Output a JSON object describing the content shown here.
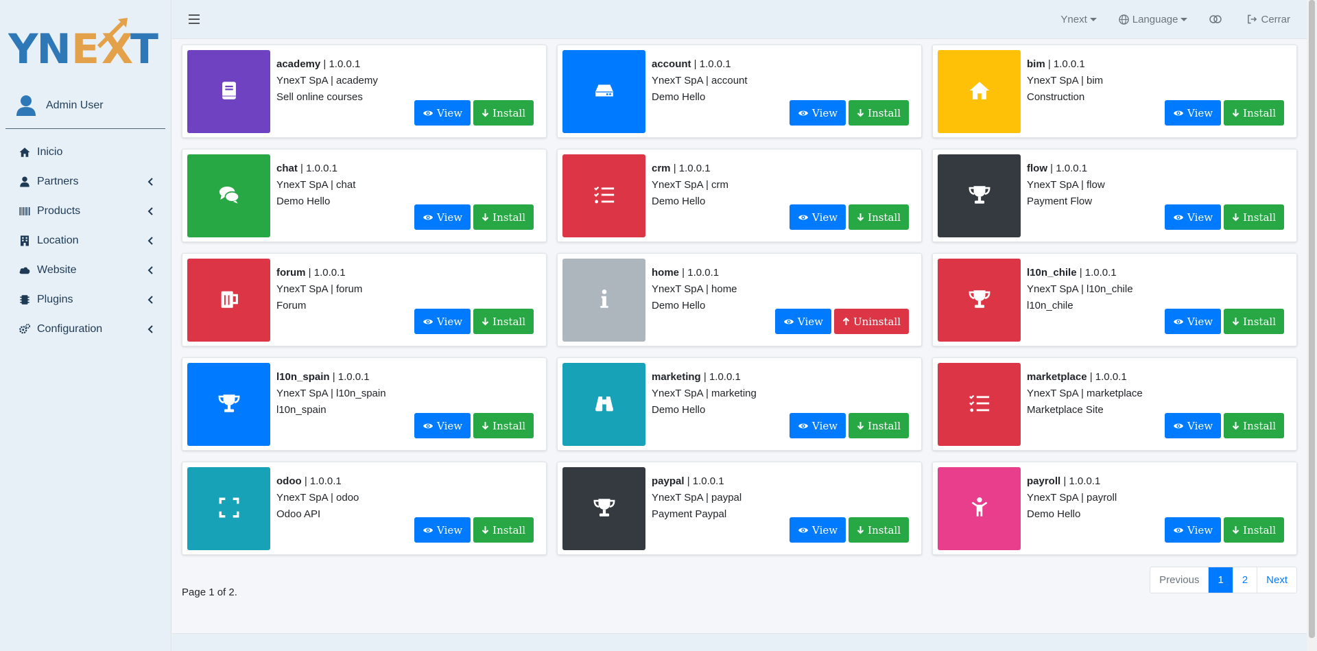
{
  "brand": {
    "logo_text": "YNEXT"
  },
  "user": {
    "name": "Admin User"
  },
  "nav": [
    {
      "label": "Inicio",
      "icon": "home-icon",
      "expandable": false
    },
    {
      "label": "Partners",
      "icon": "user-icon",
      "expandable": true
    },
    {
      "label": "Products",
      "icon": "barcode-icon",
      "expandable": true
    },
    {
      "label": "Location",
      "icon": "building-icon",
      "expandable": true
    },
    {
      "label": "Website",
      "icon": "cloud-icon",
      "expandable": true
    },
    {
      "label": "Plugins",
      "icon": "plugin-icon",
      "expandable": true
    },
    {
      "label": "Configuration",
      "icon": "cogs-icon",
      "expandable": true
    }
  ],
  "topbar": {
    "company": "Ynext",
    "language": "Language",
    "logout": "Cerrar"
  },
  "buttons": {
    "view": "View",
    "install": "Install",
    "uninstall": "Uninstall"
  },
  "modules": [
    {
      "name": "academy",
      "version": "1.0.0.1",
      "vendor": "YnexT SpA | academy",
      "desc": "Sell online courses",
      "color": "#6f42c1",
      "icon": "book-icon",
      "installed": false
    },
    {
      "name": "account",
      "version": "1.0.0.1",
      "vendor": "YnexT SpA | account",
      "desc": "Demo Hello",
      "color": "#007bff",
      "icon": "hdd-icon",
      "installed": false
    },
    {
      "name": "bim",
      "version": "1.0.0.1",
      "vendor": "YnexT SpA | bim",
      "desc": "Construction",
      "color": "#ffc107",
      "icon": "home-icon",
      "installed": false
    },
    {
      "name": "chat",
      "version": "1.0.0.1",
      "vendor": "YnexT SpA | chat",
      "desc": "Demo Hello",
      "color": "#28a745",
      "icon": "comments-icon",
      "installed": false
    },
    {
      "name": "crm",
      "version": "1.0.0.1",
      "vendor": "YnexT SpA | crm",
      "desc": "Demo Hello",
      "color": "#dc3545",
      "icon": "tasks-icon",
      "installed": false
    },
    {
      "name": "flow",
      "version": "1.0.0.1",
      "vendor": "YnexT SpA | flow",
      "desc": "Payment Flow",
      "color": "#343a40",
      "icon": "trophy-icon",
      "installed": false
    },
    {
      "name": "forum",
      "version": "1.0.0.1",
      "vendor": "YnexT SpA | forum",
      "desc": "Forum",
      "color": "#dc3545",
      "icon": "beer-icon",
      "installed": false
    },
    {
      "name": "home",
      "version": "1.0.0.1",
      "vendor": "YnexT SpA | home",
      "desc": "Demo Hello",
      "color": "#adb5bd",
      "icon": "info-icon",
      "installed": true
    },
    {
      "name": "l10n_chile",
      "version": "1.0.0.1",
      "vendor": "YnexT SpA | l10n_chile",
      "desc": "l10n_chile",
      "color": "#dc3545",
      "icon": "trophy-icon",
      "installed": false
    },
    {
      "name": "l10n_spain",
      "version": "1.0.0.1",
      "vendor": "YnexT SpA | l10n_spain",
      "desc": "l10n_spain",
      "color": "#007bff",
      "icon": "trophy-icon",
      "installed": false
    },
    {
      "name": "marketing",
      "version": "1.0.0.1",
      "vendor": "YnexT SpA | marketing",
      "desc": "Demo Hello",
      "color": "#17a2b8",
      "icon": "binoculars-icon",
      "installed": false
    },
    {
      "name": "marketplace",
      "version": "1.0.0.1",
      "vendor": "YnexT SpA | marketplace",
      "desc": "Marketplace Site",
      "color": "#dc3545",
      "icon": "tasks-icon",
      "installed": false
    },
    {
      "name": "odoo",
      "version": "1.0.0.1",
      "vendor": "YnexT SpA | odoo",
      "desc": "Odoo API",
      "color": "#17a2b8",
      "icon": "expand-icon",
      "installed": false
    },
    {
      "name": "paypal",
      "version": "1.0.0.1",
      "vendor": "YnexT SpA | paypal",
      "desc": "Payment Paypal",
      "color": "#343a40",
      "icon": "trophy-icon",
      "installed": false
    },
    {
      "name": "payroll",
      "version": "1.0.0.1",
      "vendor": "YnexT SpA | payroll",
      "desc": "Demo Hello",
      "color": "#e83e8c",
      "icon": "child-icon",
      "installed": false
    }
  ],
  "pagination": {
    "previous": "Previous",
    "pages": [
      "1",
      "2"
    ],
    "active": "1",
    "next": "Next",
    "info": "Page 1 of 2."
  }
}
